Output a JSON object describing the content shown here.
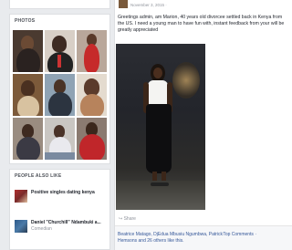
{
  "sidebar": {
    "photos_title": "PHOTOS",
    "people_title": "PEOPLE ALSO LIKE",
    "pages": [
      {
        "name": "Positive singles dating kenya",
        "sub": ""
      },
      {
        "name": "Daniel \"Churchill\" Ndambuki a...",
        "sub": "Comedian"
      }
    ]
  },
  "post": {
    "time": "November 3, 2015 · ",
    "text": "Greetings admin, am Marion, 40 years old divorcee settled back in Kenya from the US. I need a young man to have fun with, instant feedback from your will be greatly appreciated",
    "share_label": "Share",
    "likes_text": "Beatrice Matago, DjEdua Mbusiu Ngumbwa, Patrick Hemsons and 26 others like this.",
    "top_comments_label": "Top Comments ·"
  },
  "colors": {
    "link": "#365899",
    "text": "#1d2129",
    "muted": "#90949c",
    "bg": "#e9ebee"
  }
}
